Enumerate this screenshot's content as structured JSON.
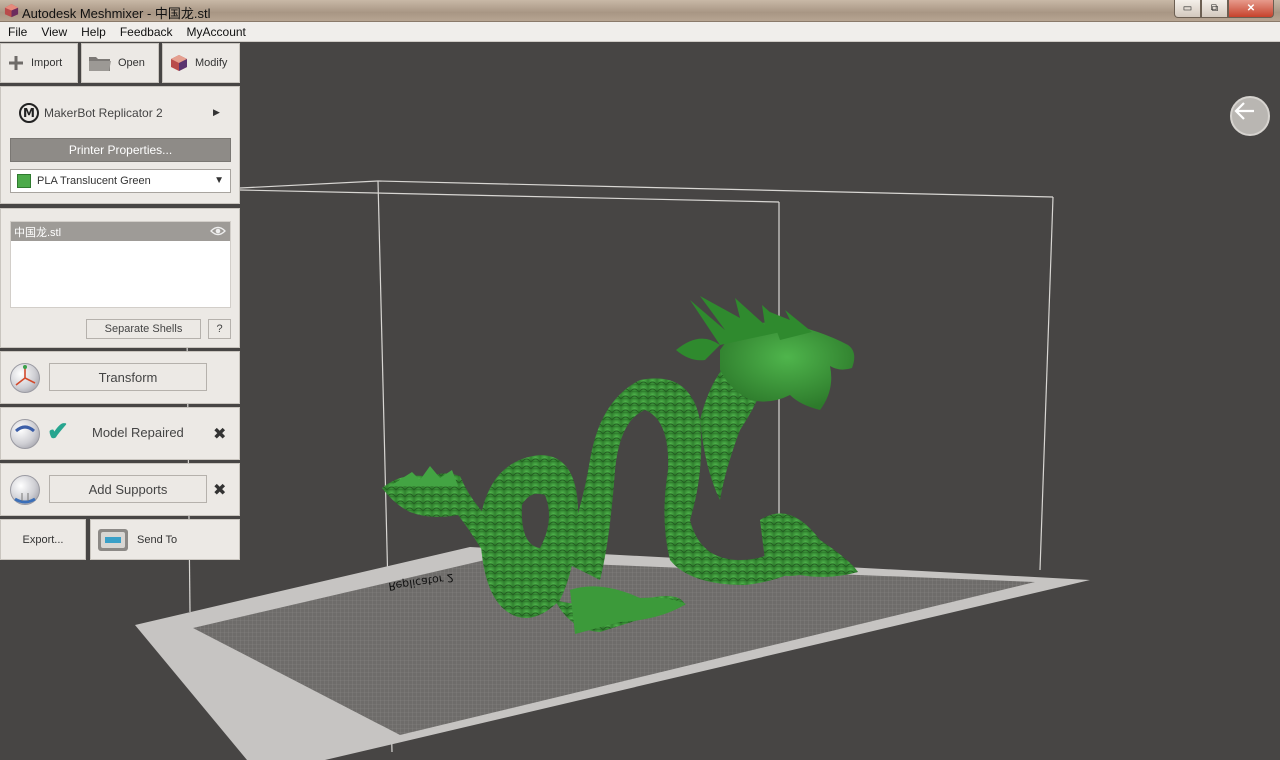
{
  "window": {
    "title": "Autodesk Meshmixer - 中国龙.stl",
    "controls": {
      "minimize": "▭",
      "maximize": "⧉",
      "close": "✕"
    }
  },
  "menu": [
    "File",
    "View",
    "Help",
    "Feedback",
    "MyAccount"
  ],
  "toolbar": {
    "import_label": "Import",
    "open_label": "Open",
    "modify_label": "Modify"
  },
  "printer": {
    "name": "MakerBot Replicator 2",
    "logo_letter": "M",
    "expand_glyph": "▶",
    "properties_label": "Printer Properties...",
    "material": "PLA Translucent Green",
    "material_color": "#4caa4a",
    "dropdown_caret": "▼"
  },
  "objects": {
    "items": [
      {
        "name": "中国龙.stl",
        "visible": true
      }
    ],
    "separate_shells_label": "Separate Shells",
    "help_label": "?"
  },
  "steps": {
    "transform_label": "Transform",
    "repair_status": "Model Repaired",
    "repair_check": "✔",
    "supports_label": "Add Supports",
    "wrench_glyph": "✖"
  },
  "bottom": {
    "export_label": "Export...",
    "send_to_label": "Send To"
  },
  "viewport": {
    "bed_label": "Replicator 2",
    "model_color": "#3f9a3d",
    "background_color": "#474544"
  }
}
